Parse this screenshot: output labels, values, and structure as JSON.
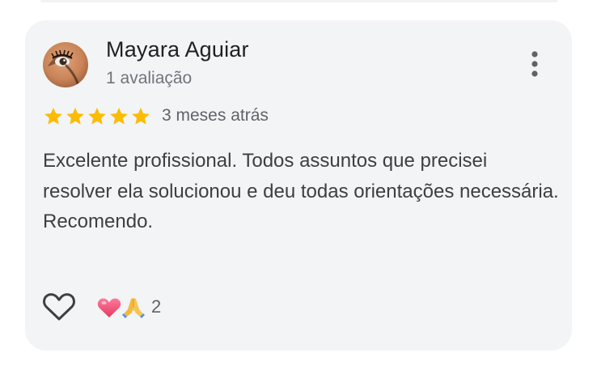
{
  "review": {
    "author_name": "Mayara Aguiar",
    "author_stats": "1 avaliação",
    "rating": 5,
    "rating_max": 5,
    "time_ago": "3 meses atrás",
    "text_lines": [
      "Excelente profissional. Todos assuntos que precisei resolver ela solucionou e deu todas orientações necessária.",
      "Recomendo."
    ],
    "reactions": {
      "icons": [
        "heart-icon",
        "praying-hands-icon"
      ],
      "count": "2"
    }
  },
  "colors": {
    "card_background": "#f3f4f6",
    "star": "#fbbc04",
    "name": "#202124",
    "secondary_text": "#70757a",
    "body_text": "#3c4043",
    "heart": "#e8456b"
  }
}
